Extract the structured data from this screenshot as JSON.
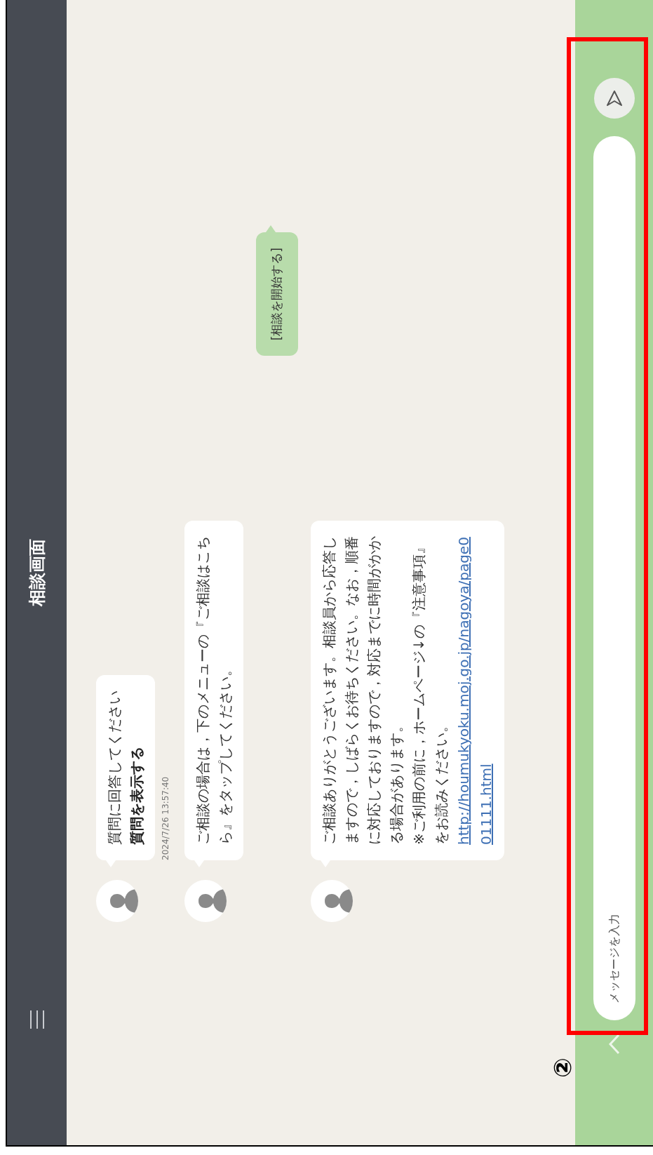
{
  "header": {
    "title": "相談画面"
  },
  "messages": [
    {
      "kind": "bot",
      "text": "質問に回答してください",
      "action": "質問を表示する",
      "timestamp": "2024/7/26 13:57:40"
    },
    {
      "kind": "bot",
      "text": "ご相談の場合は，下のメニューの『ご相談はこちら』をタップしてください。"
    },
    {
      "kind": "user",
      "text": "[相談を開始する]"
    },
    {
      "kind": "bot",
      "paragraphs": [
        "ご相談ありがとうございます。相談員から応答しますので，しばらくお待ちください。なお，順番に対応しておりますので，対応までに時間がかかる場合があります。",
        "※ご利用の前に，ホームページ↓の『注意事項』をお読みください。"
      ],
      "link": "http://houmukyoku.moj.go.jp/nagoya/page001111.html"
    }
  ],
  "composer": {
    "placeholder": "メッセージを入力"
  },
  "annotation": {
    "label": "②"
  }
}
